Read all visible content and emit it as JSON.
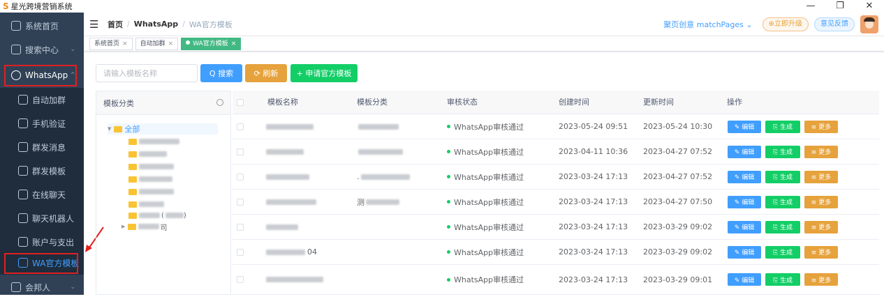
{
  "window": {
    "title": "星光跨境营销系统",
    "logo": "S",
    "controls": [
      "—",
      "❐",
      "✕"
    ]
  },
  "sidebar": {
    "items": [
      {
        "label": "系统首页",
        "icon": "home-icon"
      },
      {
        "label": "搜索中心",
        "icon": "search-center-icon",
        "arrow": "⌄"
      },
      {
        "label": "WhatsApp",
        "icon": "whatsapp-icon",
        "arrow": "^"
      },
      {
        "label": "自动加群",
        "icon": "user-add-icon"
      },
      {
        "label": "手机验证",
        "icon": "phone-verify-icon"
      },
      {
        "label": "群发消息",
        "icon": "message-icon"
      },
      {
        "label": "群发模板",
        "icon": "template-icon"
      },
      {
        "label": "在线聊天",
        "icon": "chat-icon"
      },
      {
        "label": "聊天机器人",
        "icon": "robot-icon"
      },
      {
        "label": "账户与支出",
        "icon": "account-icon"
      },
      {
        "label": "WA官方模板",
        "icon": "doc-icon"
      },
      {
        "label": "会邦人",
        "icon": "people-icon",
        "arrow": "⌄"
      }
    ]
  },
  "navbar": {
    "breadcrumb": [
      "首页",
      "WhatsApp",
      "WA官方模板"
    ],
    "right_link": "聚页创意 matchPages ⌄",
    "upgrade": "⊕立即升级",
    "feedback": "意见反馈"
  },
  "tags": [
    {
      "label": "系统首页",
      "close": "×"
    },
    {
      "label": "自动加群",
      "close": "×"
    },
    {
      "label": "WA官方模板",
      "close": "×"
    }
  ],
  "toolbar": {
    "search_placeholder": "请输入模板名称",
    "search_button": "Q 搜索",
    "refresh_button": "⟳ 刷新",
    "apply_button": "+ 申请官方模板"
  },
  "tree": {
    "header": "模板分类",
    "root": "全部",
    "partial_labels": [
      "(",
      ")",
      "：",
      "司"
    ]
  },
  "table": {
    "headers": [
      "模板名称",
      "模板分类",
      "审核状态",
      "创建时间",
      "更新时间",
      "操作"
    ],
    "status_text": "WhatsApp审核通过",
    "actions": {
      "edit": "✎ 编辑",
      "generate": "⎘ 生成",
      "more": "≡ 更多"
    },
    "rows": [
      {
        "name_partial": "",
        "category_partial": "",
        "status": "WhatsApp审核通过",
        "created": "2023-05-24 09:51",
        "updated": "2023-05-24 10:30"
      },
      {
        "name_partial": "",
        "category_partial": "",
        "status": "WhatsApp审核通过",
        "created": "2023-04-11 10:36",
        "updated": "2023-04-27 07:52"
      },
      {
        "name_partial": "",
        "category_partial": ".",
        "status": "WhatsApp审核通过",
        "created": "2023-03-24 17:13",
        "updated": "2023-04-27 07:52"
      },
      {
        "name_partial": "",
        "category_partial": "测",
        "status": "WhatsApp审核通过",
        "created": "2023-03-24 17:13",
        "updated": "2023-04-27 07:50"
      },
      {
        "name_partial": "",
        "category_partial": "",
        "status": "WhatsApp审核通过",
        "created": "2023-03-24 17:13",
        "updated": "2023-03-29 09:02"
      },
      {
        "name_partial": "04",
        "category_partial": "",
        "status": "WhatsApp审核通过",
        "created": "2023-03-24 17:13",
        "updated": "2023-03-29 09:02"
      },
      {
        "name_partial": "",
        "category_partial": "",
        "status": "WhatsApp审核通过",
        "created": "2023-03-24 17:13",
        "updated": "2023-03-29 09:01"
      }
    ]
  },
  "colors": {
    "sidebar_bg": "#304156",
    "accent_blue": "#409eff",
    "green": "#13ce66",
    "orange": "#e6a23c",
    "highlight_red": "#e02020"
  }
}
